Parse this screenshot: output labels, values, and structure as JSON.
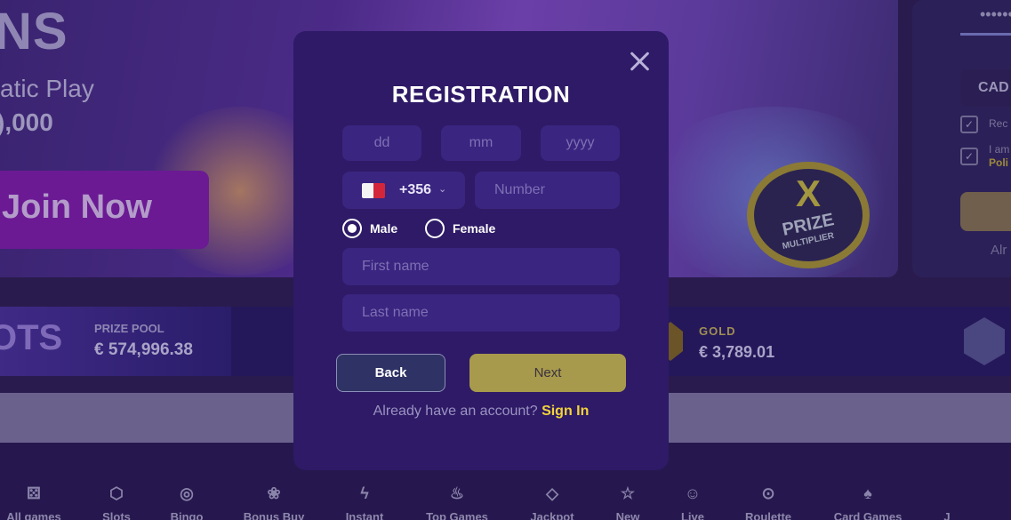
{
  "background": {
    "hero": {
      "title": "NS",
      "subtitle": "atic Play",
      "amount": "),000",
      "join_button": "Join Now",
      "badge_x": "X",
      "badge_prize": "PRIZE",
      "badge_multiplier": "MULTIPLIER"
    },
    "right_panel": {
      "password_mask": "••••••",
      "currency": "CAD",
      "check1_text": "Rec",
      "check2_text": "I am",
      "check2_sub": "Poli",
      "already": "Alr"
    },
    "jackpots": {
      "title": "OTS",
      "pool_label": "PRIZE POOL",
      "pool_value": "€ 574,996.38",
      "gold_label": "GOLD",
      "gold_value": "€ 3,789.01"
    },
    "categories": [
      {
        "label": "All games",
        "icon": "dice-icon",
        "glyph": "⚄"
      },
      {
        "label": "Slots",
        "icon": "gem-outline-icon",
        "glyph": "⬡"
      },
      {
        "label": "Bingo",
        "icon": "bingo-ball-icon",
        "glyph": "◎"
      },
      {
        "label": "Bonus Buy",
        "icon": "cherries-icon",
        "glyph": "❀"
      },
      {
        "label": "Instant",
        "icon": "lightning-icon",
        "glyph": "ϟ"
      },
      {
        "label": "Top Games",
        "icon": "flame-icon",
        "glyph": "♨"
      },
      {
        "label": "Jackpot",
        "icon": "diamond-icon",
        "glyph": "◇"
      },
      {
        "label": "New",
        "icon": "star-icon",
        "glyph": "☆"
      },
      {
        "label": "Live",
        "icon": "dealer-icon",
        "glyph": "☺"
      },
      {
        "label": "Roulette",
        "icon": "roulette-icon",
        "glyph": "⊙"
      },
      {
        "label": "Card Games",
        "icon": "cards-icon",
        "glyph": "♠"
      },
      {
        "label": "J",
        "icon": "more-icon",
        "glyph": ""
      }
    ]
  },
  "modal": {
    "title": "REGISTRATION",
    "dob": {
      "day_placeholder": "dd",
      "month_placeholder": "mm",
      "year_placeholder": "yyyy"
    },
    "phone": {
      "country_code": "+356",
      "flag": "malta-flag-icon",
      "number_placeholder": "Number"
    },
    "gender": {
      "male_label": "Male",
      "female_label": "Female",
      "selected": "Male"
    },
    "first_name_placeholder": "First name",
    "last_name_placeholder": "Last name",
    "back_label": "Back",
    "next_label": "Next",
    "already_text": "Already have an account?",
    "signin_label": "Sign In"
  },
  "colors": {
    "modal_bg": "#2e1a66",
    "field_bg": "#3a2580",
    "next_button": "#a89a4c",
    "signin_link": "#f2d43a",
    "back_button": "#2f3264"
  }
}
